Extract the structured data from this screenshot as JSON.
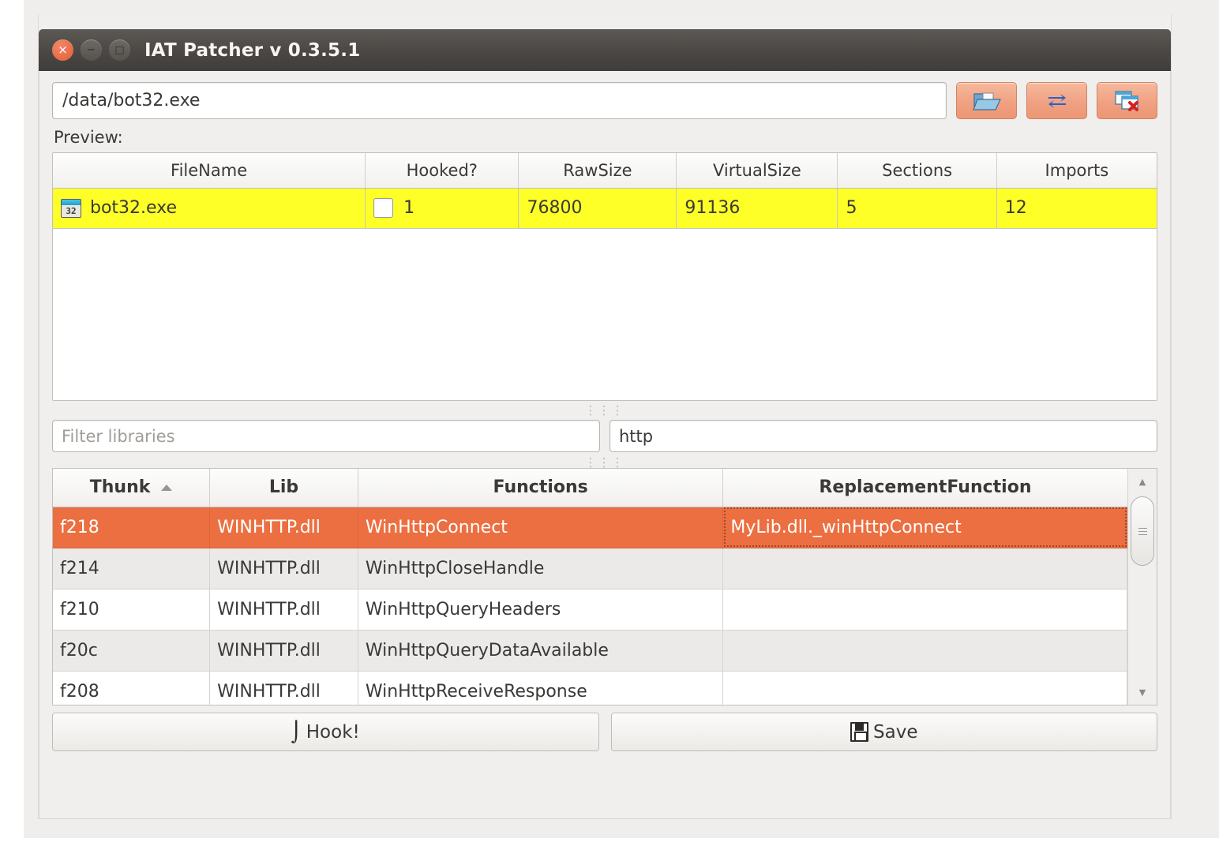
{
  "window": {
    "title": "IAT Patcher v 0.3.5.1",
    "controls": {
      "close": "×",
      "minimize": "−",
      "maximize": "□"
    }
  },
  "toolbar": {
    "path_value": "/data/bot32.exe",
    "path_placeholder": "",
    "open_button": "open-folder-icon",
    "reload_button": "refresh-icon",
    "close_all_button": "close-windows-icon"
  },
  "preview": {
    "label": "Preview:",
    "columns": [
      "FileName",
      "Hooked?",
      "RawSize",
      "VirtualSize",
      "Sections",
      "Imports"
    ],
    "rows": [
      {
        "filename": "bot32.exe",
        "icon": "exe32-icon",
        "hooked": "1",
        "hooked_checked": false,
        "rawsize": "76800",
        "virtualsize": "91136",
        "sections": "5",
        "imports": "12"
      }
    ]
  },
  "filters": {
    "library_placeholder": "Filter libraries",
    "library_value": "",
    "function_value": "http",
    "function_placeholder": ""
  },
  "functions": {
    "columns": [
      "Thunk",
      "Lib",
      "Functions",
      "ReplacementFunction"
    ],
    "sorted_column": "Thunk",
    "sort_direction": "ascending",
    "rows": [
      {
        "thunk": "f218",
        "lib": "WINHTTP.dll",
        "function": "WinHttpConnect",
        "replacement": "MyLib.dll._winHttpConnect",
        "selected": true
      },
      {
        "thunk": "f214",
        "lib": "WINHTTP.dll",
        "function": "WinHttpCloseHandle",
        "replacement": "",
        "selected": false
      },
      {
        "thunk": "f210",
        "lib": "WINHTTP.dll",
        "function": "WinHttpQueryHeaders",
        "replacement": "",
        "selected": false
      },
      {
        "thunk": "f20c",
        "lib": "WINHTTP.dll",
        "function": "WinHttpQueryDataAvailable",
        "replacement": "",
        "selected": false
      },
      {
        "thunk": "f208",
        "lib": "WINHTTP.dll",
        "function": "WinHttpReceiveResponse",
        "replacement": "",
        "selected": false
      }
    ]
  },
  "actions": {
    "hook_label": "Hook!",
    "hook_glyph": "⌡",
    "save_label": "Save"
  },
  "colors": {
    "accent": "#ec6f41",
    "row_highlight": "#ffff28",
    "sections_value": "#19a319",
    "imports_value": "#ee2222",
    "titlebar": "#4a4744",
    "button_face": "#f0a183"
  }
}
